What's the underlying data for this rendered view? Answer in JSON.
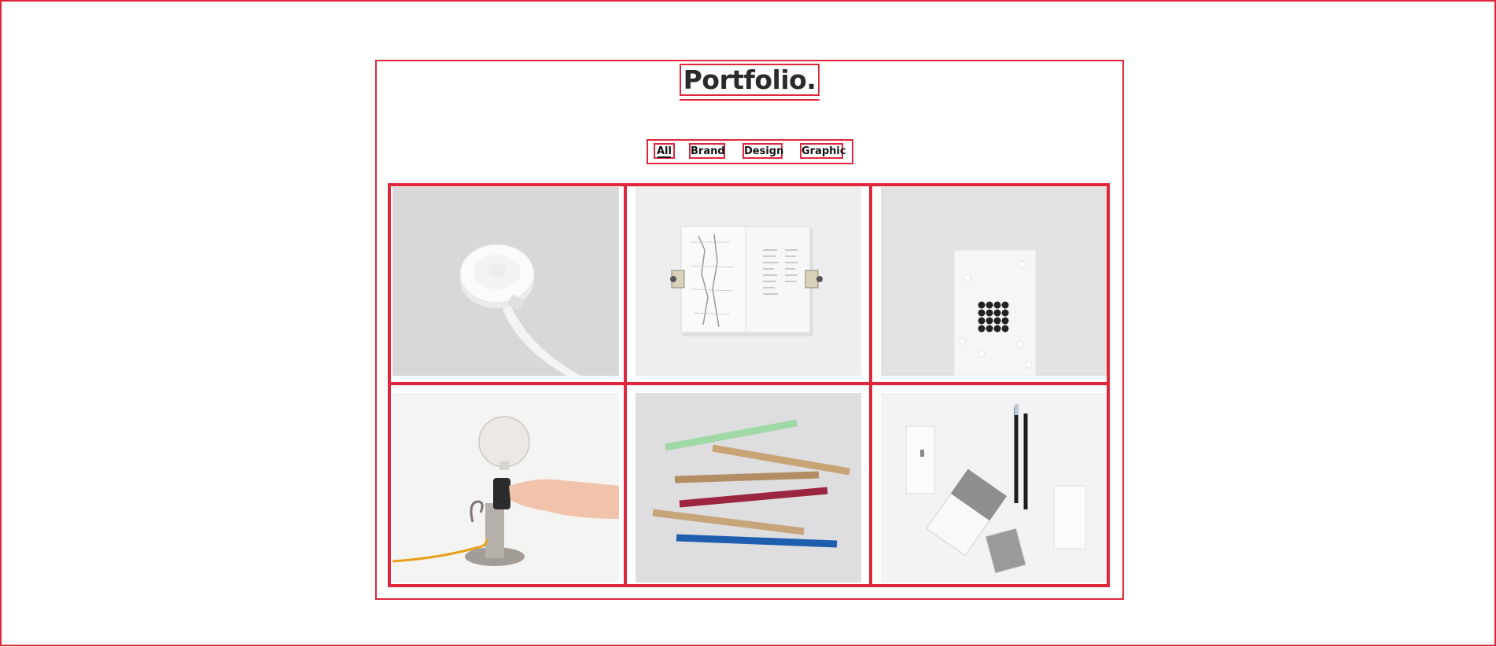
{
  "header": {
    "title": "Portfolio."
  },
  "filters": [
    {
      "label": "All",
      "active": true
    },
    {
      "label": "Brand",
      "active": false
    },
    {
      "label": "Design",
      "active": false
    },
    {
      "label": "Graphic",
      "active": false
    }
  ],
  "gallery": {
    "items": [
      {
        "icon": "charging-puck-photo"
      },
      {
        "icon": "open-map-book-photo"
      },
      {
        "icon": "dotted-card-photo"
      },
      {
        "icon": "lamp-hand-photo"
      },
      {
        "icon": "colored-rulers-photo"
      },
      {
        "icon": "stationery-set-photo"
      }
    ]
  },
  "colors": {
    "outline": "#e0263b",
    "text": "#1b1b1b"
  }
}
